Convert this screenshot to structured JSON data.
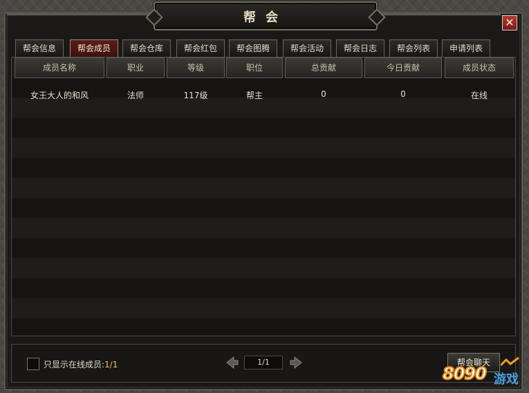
{
  "window": {
    "title": "帮会",
    "close_glyph": "✕"
  },
  "tabs": [
    {
      "label": "帮会信息",
      "active": false
    },
    {
      "label": "帮会成员",
      "active": true
    },
    {
      "label": "帮会仓库",
      "active": false
    },
    {
      "label": "帮会红包",
      "active": false
    },
    {
      "label": "帮会图腾",
      "active": false
    },
    {
      "label": "帮会活动",
      "active": false
    },
    {
      "label": "帮会日志",
      "active": false
    },
    {
      "label": "帮会列表",
      "active": false
    },
    {
      "label": "申请列表",
      "active": false
    }
  ],
  "table": {
    "columns": [
      "成员名称",
      "职业",
      "等级",
      "职位",
      "总贡献",
      "今日贡献",
      "成员状态"
    ],
    "rows": [
      [
        "女王大人的和风",
        "法师",
        "117级",
        "帮主",
        "0",
        "0",
        "在线"
      ]
    ]
  },
  "footer": {
    "online_only_label": "只显示在线成员:",
    "online_count": "1/1",
    "page": "1/1",
    "chat_button": "帮会聊天"
  },
  "watermark": {
    "number": "8090",
    "text": "游戏"
  },
  "colors": {
    "accent_tab": "#5a1e17",
    "close_button": "#b53a30",
    "online_count": "#e8c85a"
  }
}
